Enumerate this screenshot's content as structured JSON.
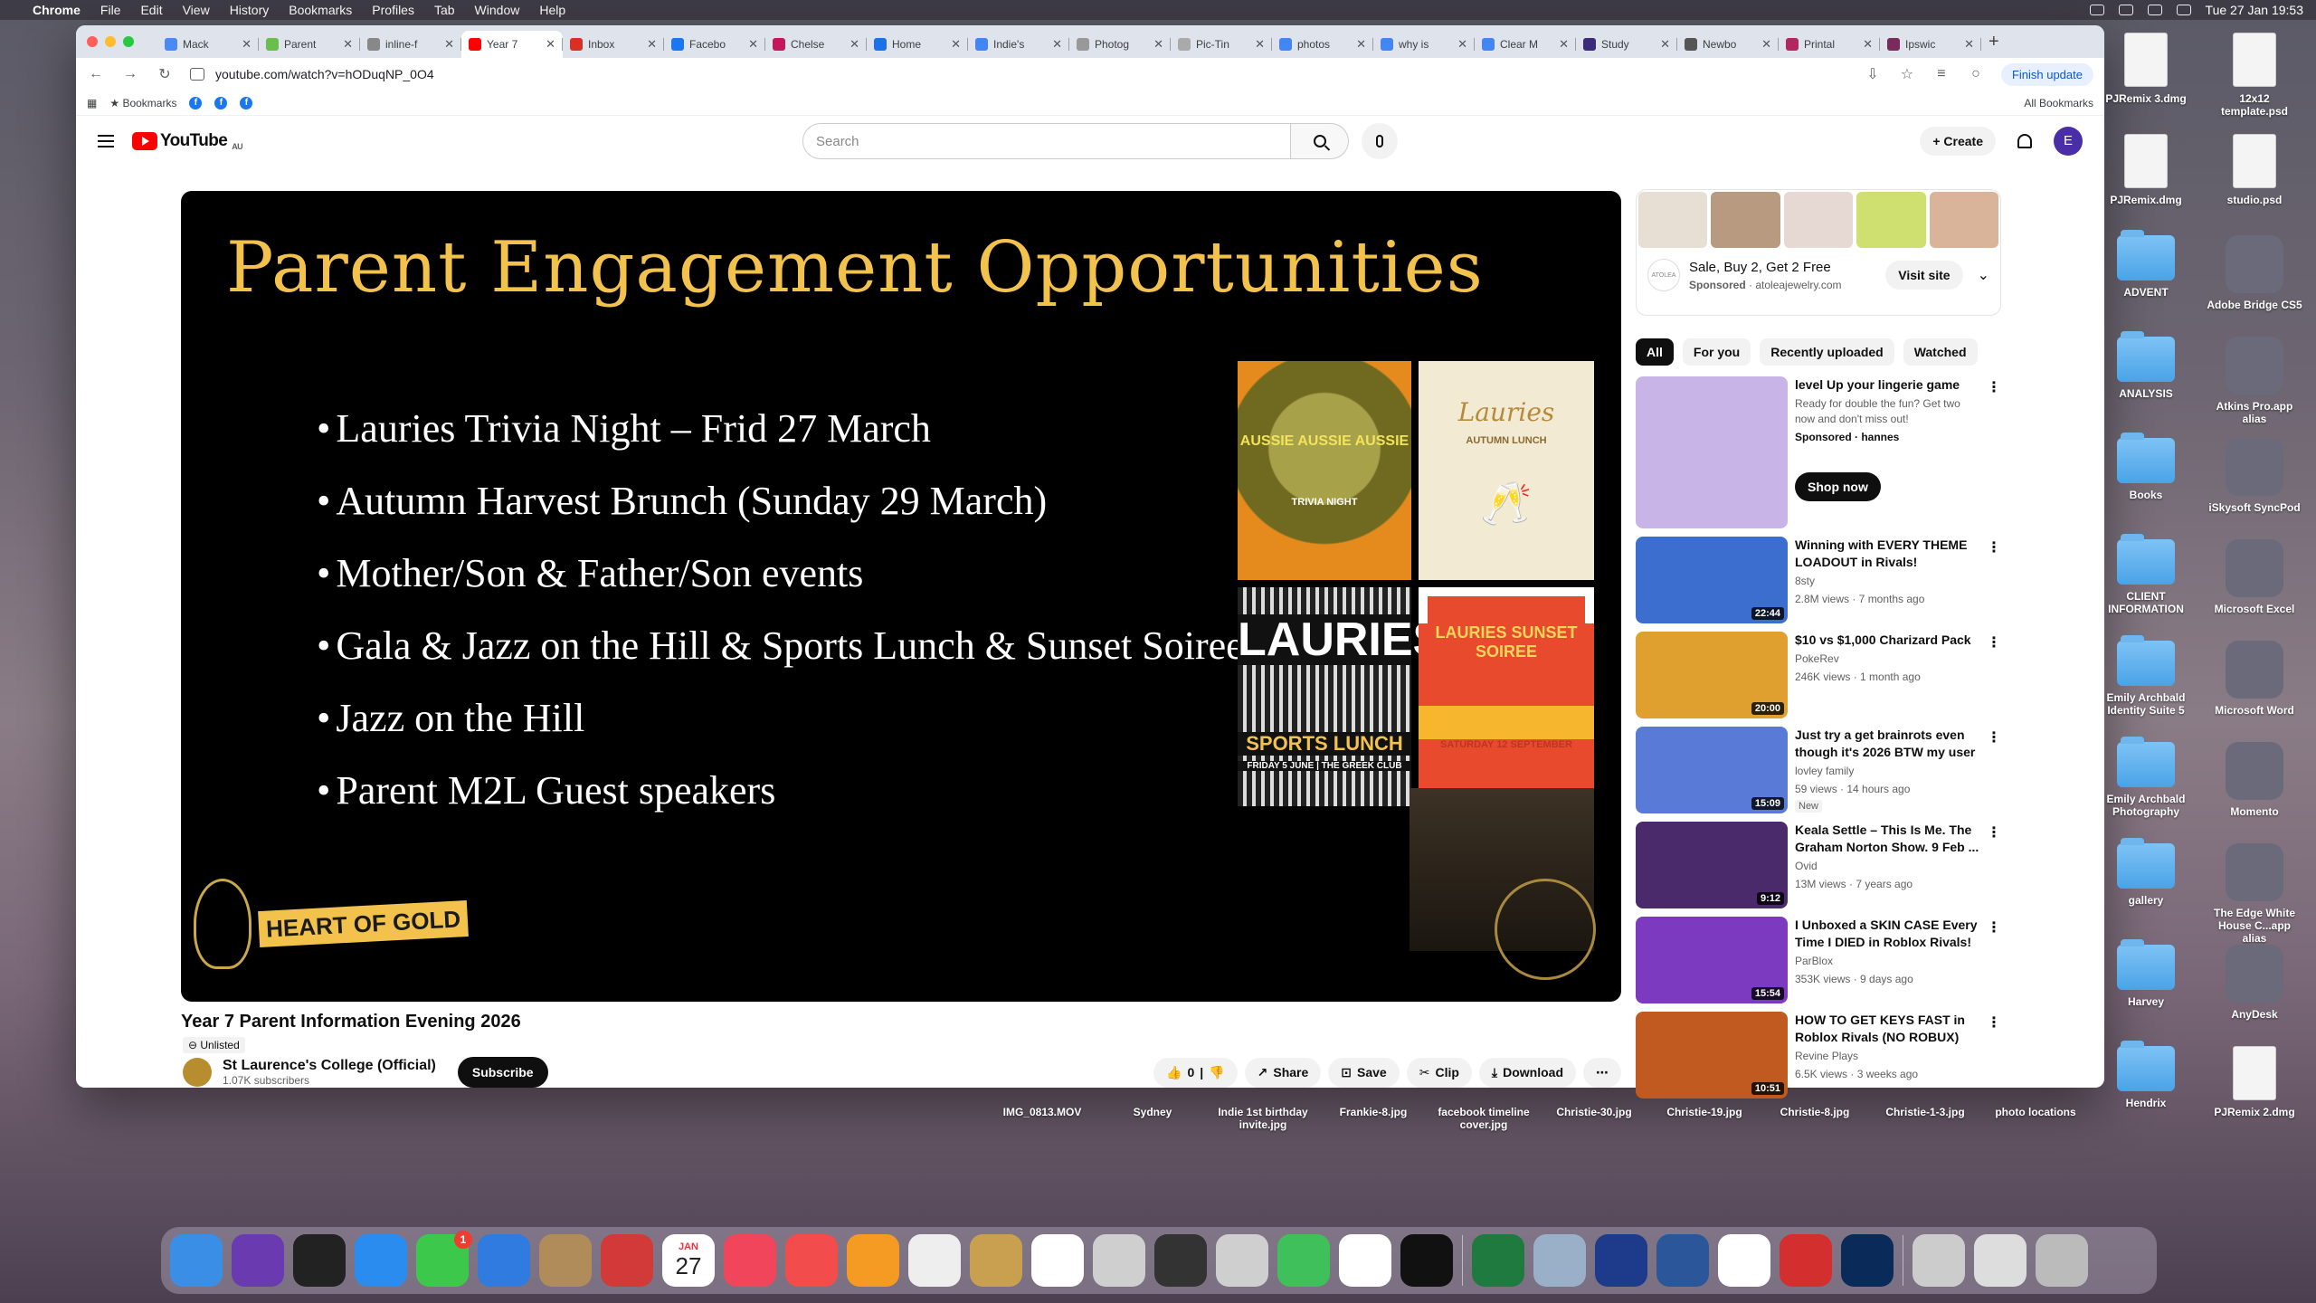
{
  "menubar": {
    "app": "Chrome",
    "items": [
      "File",
      "Edit",
      "View",
      "History",
      "Bookmarks",
      "Profiles",
      "Tab",
      "Window",
      "Help"
    ],
    "clock": "Tue 27 Jan  19:53"
  },
  "tabs": [
    {
      "label": "Mack",
      "color": "#4a8af4"
    },
    {
      "label": "Parent",
      "color": "#6abf4b"
    },
    {
      "label": "inline-f",
      "color": "#888888"
    },
    {
      "label": "Year 7",
      "color": "#ff0000"
    },
    {
      "label": "Inbox",
      "color": "#d93025"
    },
    {
      "label": "Facebo",
      "color": "#1877f2"
    },
    {
      "label": "Chelse",
      "color": "#c2185b"
    },
    {
      "label": "Home",
      "color": "#1a73e8"
    },
    {
      "label": "Indie's",
      "color": "#4285f4"
    },
    {
      "label": "Photog",
      "color": "#999999"
    },
    {
      "label": "Pic-Tin",
      "color": "#aaaaaa"
    },
    {
      "label": "photos",
      "color": "#4285f4"
    },
    {
      "label": "why is",
      "color": "#4285f4"
    },
    {
      "label": "Clear M",
      "color": "#4285f4"
    },
    {
      "label": "Study",
      "color": "#3c2a7a"
    },
    {
      "label": "Newbo",
      "color": "#555555"
    },
    {
      "label": "Printal",
      "color": "#b3265f"
    },
    {
      "label": "Ipswic",
      "color": "#7a2b5e"
    }
  ],
  "toolbar": {
    "url": "youtube.com/watch?v=hODuqNP_0O4",
    "finish_update": "Finish update"
  },
  "bookmarks": {
    "label": "Bookmarks",
    "all": "All Bookmarks",
    "fb_glyph": "f"
  },
  "yt": {
    "region": "AU",
    "logo_text": "YouTube",
    "search_placeholder": "Search",
    "create": "Create",
    "avatar": "E"
  },
  "slide": {
    "title": "Parent Engagement Opportunities",
    "bullets": [
      "Lauries Trivia Night – Frid 27 March",
      "Autumn Harvest Brunch (Sunday 29 March)",
      "Mother/Son & Father/Son events",
      "Gala & Jazz on the Hill & Sports Lunch & Sunset Soiree",
      "Jazz on the Hill",
      "Parent M2L Guest speakers"
    ],
    "poster1": "AUSSIE AUSSIE AUSSIE",
    "poster1_sub": "TRIVIA NIGHT",
    "poster2": "Lauries",
    "poster2_sub": "AUTUMN LUNCH",
    "poster3": "LAURIES",
    "poster3_sub": "SPORTS LUNCH",
    "poster3_date": "FRIDAY 5 JUNE | THE GREEK CLUB",
    "poster4": "LAURIES SUNSET SOIREE",
    "poster4_date": "SATURDAY 12 SEPTEMBER",
    "heart_of_gold": "HEART OF GOLD"
  },
  "video": {
    "title": "Year 7 Parent Information Evening 2026",
    "visibility": "Unlisted",
    "channel": "St Laurence's College (Official)",
    "subs": "1.07K subscribers",
    "subscribe": "Subscribe",
    "likes": "0",
    "share": "Share",
    "save": "Save",
    "clip": "Clip",
    "download": "Download"
  },
  "ad": {
    "brand": "ATOLEA",
    "title": "Sale, Buy 2, Get 2 Free",
    "sponsored": "Sponsored",
    "domain": "atoleajewelry.com",
    "visit": "Visit site"
  },
  "chips": [
    "All",
    "For you",
    "Recently uploaded",
    "Watched"
  ],
  "recs": [
    {
      "title": "level Up your lingerie game",
      "line2": "Ready for double the fun? Get two now and don't miss out!",
      "line3": "Sponsored · hannes",
      "cta": "Shop now",
      "bg": "#c9b4e8"
    },
    {
      "title": "Winning with EVERY THEME LOADOUT in Rivals!",
      "channel": "8sty",
      "stats": "2.8M views · 7 months ago",
      "duration": "22:44",
      "bg": "#3b6ecf"
    },
    {
      "title": "$10 vs $1,000 Charizard Pack",
      "channel": "PokeRev",
      "stats": "246K views · 1 month ago",
      "duration": "20:00",
      "bg": "#e0a030"
    },
    {
      "title": "Just try a get brainrots even though it's 2026 BTW my user ...",
      "channel": "lovley family",
      "stats": "59 views · 14 hours ago",
      "badge": "New",
      "duration": "15:09",
      "bg": "#5a7ad8"
    },
    {
      "title": "Keala Settle – This Is Me. The Graham Norton Show. 9 Feb ...",
      "channel": "Ovid",
      "stats": "13M views · 7 years ago",
      "duration": "9:12",
      "bg": "#4a2a6a"
    },
    {
      "title": "I Unboxed a SKIN CASE Every Time I DIED in Roblox Rivals!",
      "channel": "ParBlox",
      "stats": "353K views · 9 days ago",
      "duration": "15:54",
      "bg": "#7c3ac0"
    },
    {
      "title": "HOW TO GET KEYS FAST in Roblox Rivals (NO ROBUX)",
      "channel": "Revine Plays",
      "stats": "6.5K views · 3 weeks ago",
      "duration": "10:51",
      "bg": "#c05a20"
    }
  ],
  "desktop": {
    "col1": [
      "PJRemix 3.dmg",
      "PJRemix.dmg",
      "ADVENT",
      "ANALYSIS",
      "Books",
      "CLIENT INFORMATION",
      "Emily Archbald Identity Suite 5",
      "Emily Archbald Photography",
      "gallery",
      "Harvey",
      "Hendrix"
    ],
    "col2": [
      "12x12 template.psd",
      "studio.psd",
      "Adobe Bridge CS5",
      "Atkins Pro.app alias",
      "iSkysoft SyncPod",
      "Microsoft Excel",
      "Microsoft Word",
      "Momento",
      "The Edge White House C...app alias",
      "AnyDesk",
      "PJRemix 2.dmg"
    ],
    "row": [
      "IMG_0813.MOV",
      "Sydney",
      "Indie 1st birthday invite.jpg",
      "Frankie-8.jpg",
      "facebook timeline cover.jpg",
      "Christie-30.jpg",
      "Christie-19.jpg",
      "Christie-8.jpg",
      "Christie-1-3.jpg",
      "photo locations"
    ]
  },
  "dock": {
    "apps": [
      "Finder",
      "Siri",
      "Launchpad",
      "App Store",
      "FaceTime",
      "Safari",
      "Contacts",
      "Photo Booth",
      "Calendar",
      "Music",
      "News",
      "Books",
      "TextEdit",
      "Sonos",
      "Photos",
      "Help",
      "Sonos S1",
      "Help",
      "Messages",
      "Freeform",
      "TV",
      "Excel",
      "Preview",
      "Lightroom Classic",
      "Word",
      "Chrome",
      "Acrobat",
      "Photoshop",
      "Screenshots",
      "Documents",
      "Trash"
    ],
    "facetime_badge": "1",
    "calendar_month": "JAN",
    "calendar_day": "27"
  }
}
